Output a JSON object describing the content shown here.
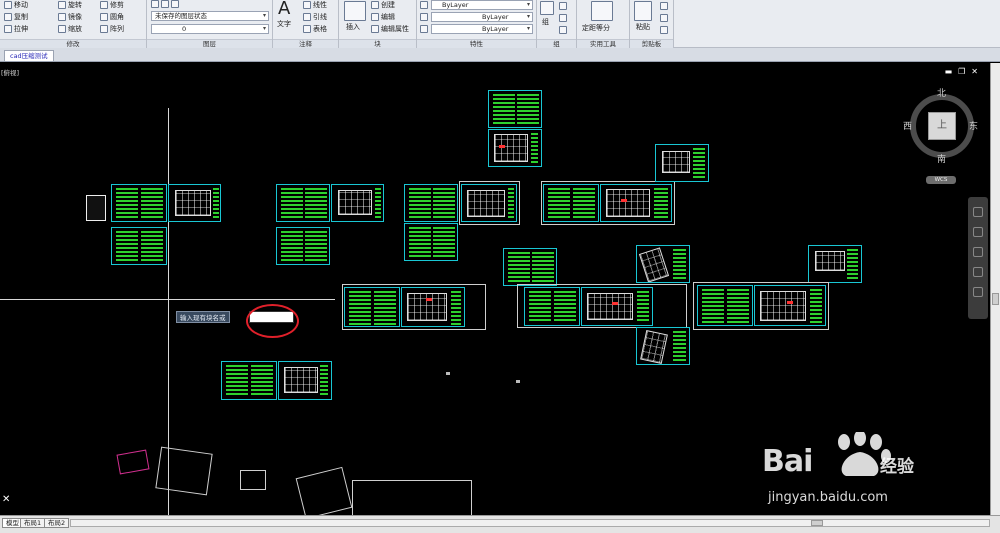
{
  "ribbon": {
    "modify": {
      "title": "修改",
      "items": [
        "移动",
        "旋转",
        "修剪",
        "复制",
        "镜像",
        "圆角",
        "拉伸",
        "缩放",
        "阵列"
      ]
    },
    "layers": {
      "title": "图层",
      "layer_state": "未保存的图层状态",
      "current_layer": "0"
    },
    "annotation": {
      "title": "注释",
      "text_label": "文字",
      "items": [
        "线性",
        "引线",
        "表格"
      ]
    },
    "block": {
      "title": "块",
      "insert_label": "插入",
      "items": [
        "创建",
        "编辑",
        "编辑属性"
      ]
    },
    "properties": {
      "title": "特性",
      "color": "ByLayer",
      "linetype": "ByLayer",
      "lineweight": "ByLayer"
    },
    "group": {
      "title": "组",
      "label": "组"
    },
    "utilities": {
      "title": "实用工具",
      "label": "定距等分"
    },
    "clipboard": {
      "title": "剪贴板",
      "label": "粘贴"
    }
  },
  "document_tab": "cad压缩测试",
  "viewport": {
    "view_label": "[俯视]",
    "command_prompt": "输入现有块名或",
    "command_input_value": "",
    "viewcube": {
      "north": "北",
      "south": "南",
      "east": "东",
      "west": "西",
      "face": "上",
      "wcs": "WCS"
    }
  },
  "layout_tabs": [
    "模型",
    "布局1",
    "布局2"
  ],
  "watermark": {
    "brand": "Bai",
    "brand2": "经验",
    "url": "jingyan.baidu.com"
  },
  "colors": {
    "sheet_border": "#19c7d4",
    "text_lines": "#2ed12e",
    "annotation_circle": "#e0202a",
    "background": "#000000"
  }
}
